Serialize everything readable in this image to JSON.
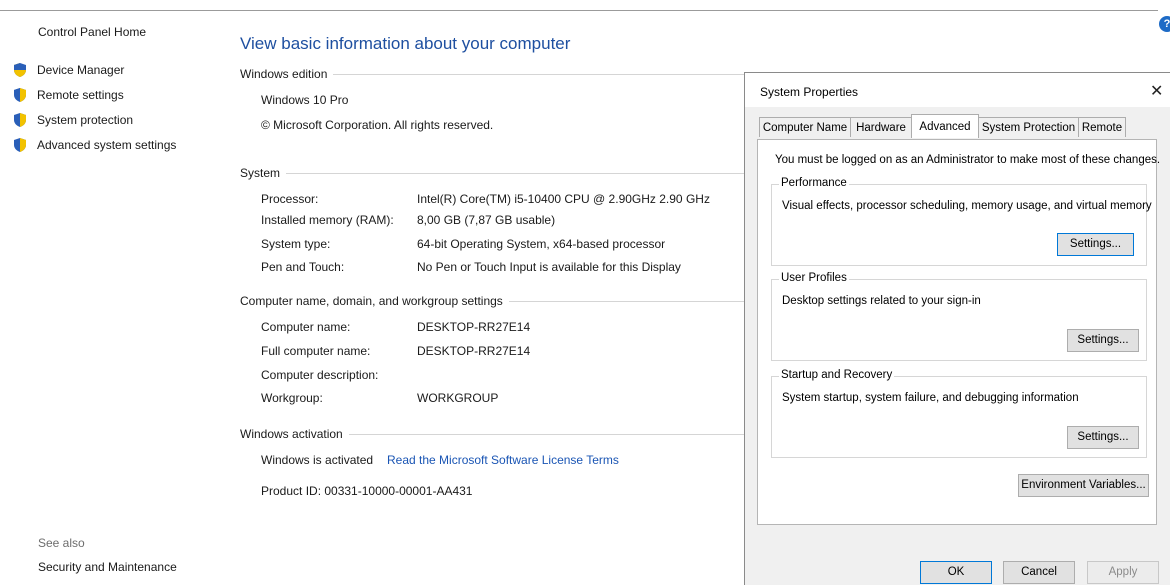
{
  "nav": {
    "home": "Control Panel Home",
    "items": [
      "Device Manager",
      "Remote settings",
      "System protection",
      "Advanced system settings"
    ],
    "see_also": "See also",
    "see_also_links": [
      "Security and Maintenance"
    ]
  },
  "main": {
    "title": "View basic information about your computer",
    "edition": {
      "heading": "Windows edition",
      "name": "Windows 10 Pro",
      "copyright": "© Microsoft Corporation. All rights reserved."
    },
    "system": {
      "heading": "System",
      "rows": [
        {
          "label": "Processor:",
          "value": "Intel(R) Core(TM) i5-10400 CPU @ 2.90GHz   2.90 GHz"
        },
        {
          "label": "Installed memory (RAM):",
          "value": "8,00 GB (7,87 GB usable)"
        },
        {
          "label": "System type:",
          "value": "64-bit Operating System, x64-based processor"
        },
        {
          "label": "Pen and Touch:",
          "value": "No Pen or Touch Input is available for this Display"
        }
      ]
    },
    "computer": {
      "heading": "Computer name, domain, and workgroup settings",
      "rows": [
        {
          "label": "Computer name:",
          "value": "DESKTOP-RR27E14"
        },
        {
          "label": "Full computer name:",
          "value": "DESKTOP-RR27E14"
        },
        {
          "label": "Computer description:",
          "value": ""
        },
        {
          "label": "Workgroup:",
          "value": "WORKGROUP"
        }
      ]
    },
    "activation": {
      "heading": "Windows activation",
      "status": "Windows is activated",
      "license_link": "Read the Microsoft Software License Terms",
      "product_id": "Product ID: 00331-10000-00001-AA431"
    }
  },
  "dialog": {
    "title": "System Properties",
    "tabs": [
      "Computer Name",
      "Hardware",
      "Advanced",
      "System Protection",
      "Remote"
    ],
    "active_tab": "Advanced",
    "admin_note": "You must be logged on as an Administrator to make most of these changes.",
    "performance": {
      "title": "Performance",
      "desc": "Visual effects, processor scheduling, memory usage, and virtual memory",
      "button": "Settings..."
    },
    "profiles": {
      "title": "User Profiles",
      "desc": "Desktop settings related to your sign-in",
      "button": "Settings..."
    },
    "startup": {
      "title": "Startup and Recovery",
      "desc": "System startup, system failure, and debugging information",
      "button": "Settings..."
    },
    "env_button": "Environment Variables...",
    "ok": "OK",
    "cancel": "Cancel",
    "apply": "Apply"
  },
  "colors": {
    "accent": "#1e4fa0",
    "link": "#1a55b4",
    "shield_blue": "#2a5fb8",
    "shield_yellow": "#f2c200"
  },
  "icons": {
    "shield": "uac-shield-icon",
    "help": "help-icon",
    "close": "close-icon"
  }
}
